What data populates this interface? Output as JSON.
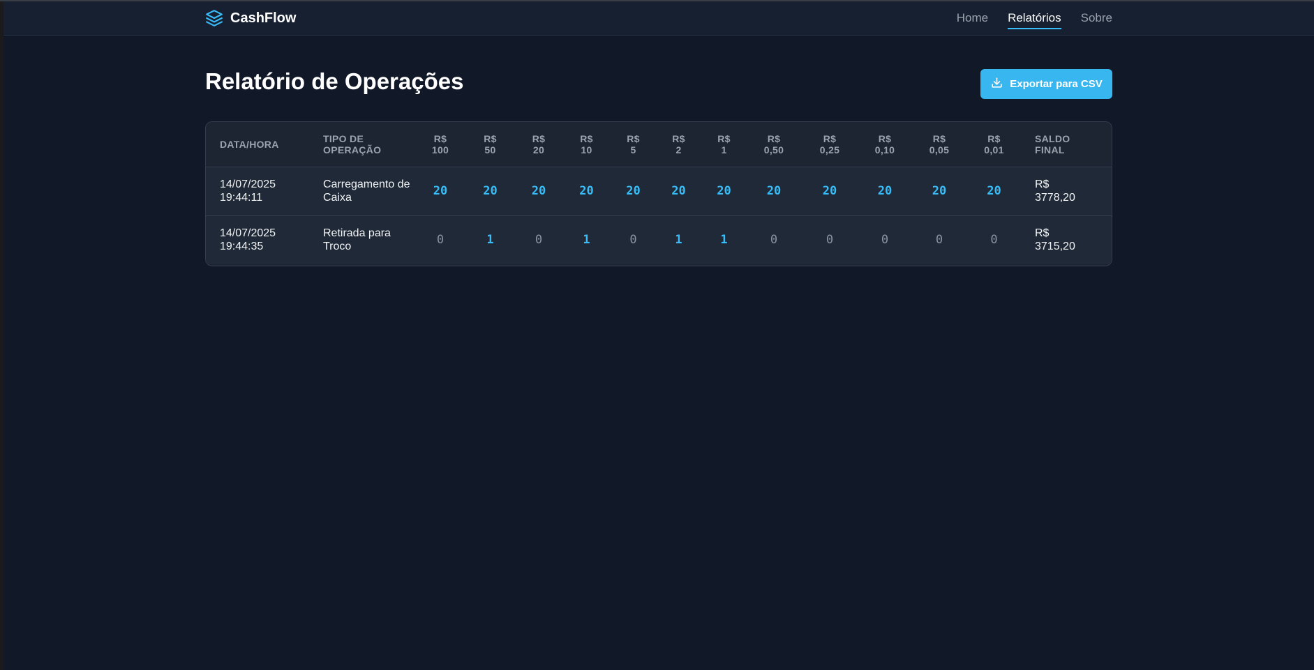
{
  "app": {
    "name": "CashFlow",
    "logo_icon": "layers-icon",
    "accent_color": "#38bdf8",
    "background_color": "#111827"
  },
  "nav": {
    "links": [
      {
        "label": "Home",
        "active": false
      },
      {
        "label": "Relatórios",
        "active": true
      },
      {
        "label": "Sobre",
        "active": false
      }
    ]
  },
  "page": {
    "title": "Relatório de Operações",
    "export_label": "Exportar para CSV",
    "export_icon": "download-icon"
  },
  "table": {
    "headers": {
      "datetime": [
        "DATA/HORA"
      ],
      "type": [
        "TIPO DE",
        "OPERAÇÃO"
      ],
      "denominations": [
        [
          "R$",
          "100"
        ],
        [
          "R$",
          "50"
        ],
        [
          "R$",
          "20"
        ],
        [
          "R$",
          "10"
        ],
        [
          "R$",
          "5"
        ],
        [
          "R$",
          "2"
        ],
        [
          "R$",
          "1"
        ],
        [
          "R$",
          "0,50"
        ],
        [
          "R$",
          "0,25"
        ],
        [
          "R$",
          "0,10"
        ],
        [
          "R$",
          "0,05"
        ],
        [
          "R$",
          "0,01"
        ]
      ],
      "balance": [
        "SALDO",
        "FINAL"
      ]
    },
    "rows": [
      {
        "date": "14/07/2025",
        "time": "19:44:11",
        "type_lines": [
          "Carregamento de",
          "Caixa"
        ],
        "quantities": [
          "20",
          "20",
          "20",
          "20",
          "20",
          "20",
          "20",
          "20",
          "20",
          "20",
          "20",
          "20"
        ],
        "balance_lines": [
          "R$",
          "3778,20"
        ]
      },
      {
        "date": "14/07/2025",
        "time": "19:44:35",
        "type_lines": [
          "Retirada para",
          "Troco"
        ],
        "quantities": [
          "0",
          "1",
          "0",
          "1",
          "0",
          "1",
          "1",
          "0",
          "0",
          "0",
          "0",
          "0"
        ],
        "balance_lines": [
          "R$",
          "3715,20"
        ]
      }
    ]
  }
}
